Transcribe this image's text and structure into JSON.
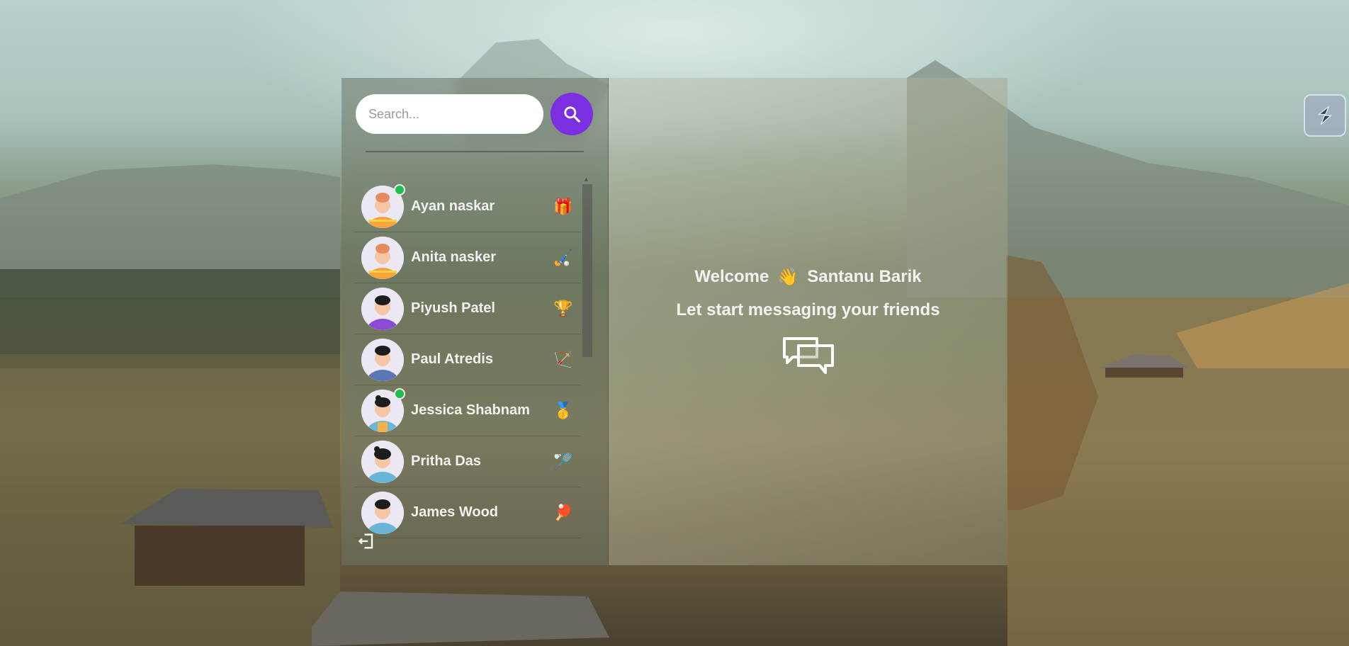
{
  "search": {
    "placeholder": "Search..."
  },
  "users": [
    {
      "name": "Ayan naskar",
      "online": true,
      "badge": "🎁",
      "badge_icon": "gift-icon"
    },
    {
      "name": "Anita nasker",
      "online": false,
      "badge": "🏑",
      "badge_icon": "hockey-icon"
    },
    {
      "name": "Piyush Patel",
      "online": false,
      "badge": "🏆",
      "badge_icon": "trophy-icon"
    },
    {
      "name": "Paul Atredis",
      "online": false,
      "badge": "🏹",
      "badge_icon": "bow-arrow-icon"
    },
    {
      "name": "Jessica Shabnam",
      "online": true,
      "badge": "🥇",
      "badge_icon": "medal-icon"
    },
    {
      "name": "Pritha Das",
      "online": false,
      "badge": "🏸",
      "badge_icon": "badminton-icon"
    },
    {
      "name": "James Wood",
      "online": false,
      "badge": "🏓",
      "badge_icon": "ping-pong-icon"
    }
  ],
  "welcome": {
    "greeting": "Welcome",
    "wave": "👋",
    "user_name": "Santanu Barik",
    "subtitle": "Let start messaging your friends"
  },
  "colors": {
    "accent": "#7b2fe0",
    "online": "#1fbf4b"
  }
}
